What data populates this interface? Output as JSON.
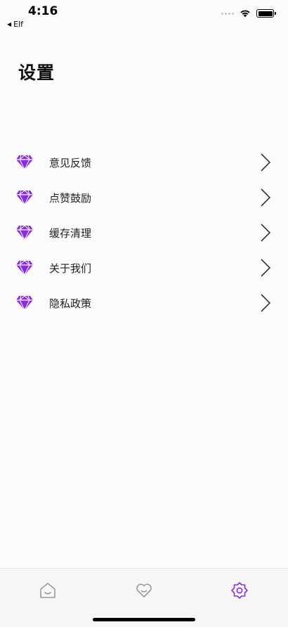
{
  "status_bar": {
    "time": "4:16",
    "back_app": "Elf"
  },
  "page": {
    "title": "设置"
  },
  "menu": {
    "items": [
      {
        "label": "意见反馈",
        "icon": "diamond-icon"
      },
      {
        "label": "点赞鼓励",
        "icon": "diamond-icon"
      },
      {
        "label": "缓存清理",
        "icon": "diamond-icon"
      },
      {
        "label": "关于我们",
        "icon": "diamond-icon"
      },
      {
        "label": "隐私政策",
        "icon": "diamond-icon"
      }
    ]
  },
  "tabbar": {
    "tabs": [
      {
        "icon": "home-icon",
        "active": false
      },
      {
        "icon": "heart-icon",
        "active": false
      },
      {
        "icon": "settings-icon",
        "active": true
      }
    ]
  },
  "colors": {
    "accent": "#8a2be2",
    "inactive_icon": "#9a9a9a",
    "background": "#fbfbfb"
  }
}
